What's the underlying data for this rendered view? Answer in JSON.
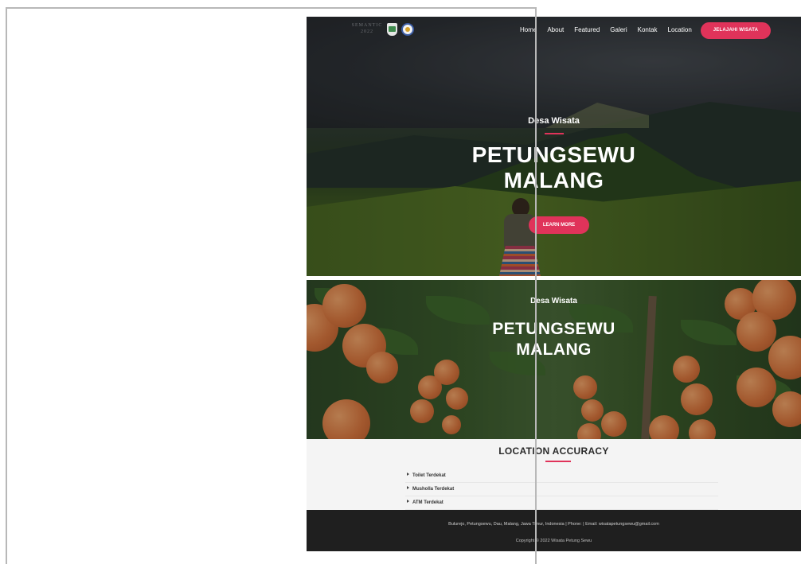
{
  "nav": {
    "logo_text_line1": "SEMANTIC",
    "logo_text_line2": "2022",
    "links": [
      "Home",
      "About",
      "Featured",
      "Galeri",
      "Kontak",
      "Location"
    ],
    "cta_label": "JELAJAHI WISATA"
  },
  "hero1": {
    "subtitle": "Desa Wisata",
    "title_line1": "PETUNGSEWU",
    "title_line2": "MALANG",
    "button_label": "LEARN MORE"
  },
  "hero2": {
    "subtitle": "Desa Wisata",
    "title_line1": "PETUNGSEWU",
    "title_line2": "MALANG"
  },
  "location": {
    "title": "LOCATION ACCURACY",
    "items": [
      "Toilet Terdekat",
      "Musholla Terdekat",
      "ATM Terdekat"
    ]
  },
  "footer": {
    "info": "Bulurejo, Petungsewu, Dau, Malang, Jawa Timur, Indonesia | Phone: | Email: wisatapetungsewu@gmail.com",
    "copyright": "Copyright © 2022 Wisata Petung Sewu"
  },
  "colors": {
    "accent": "#e0335a",
    "footer_bg": "#1f1f1f",
    "section_bg": "#f4f4f4"
  }
}
